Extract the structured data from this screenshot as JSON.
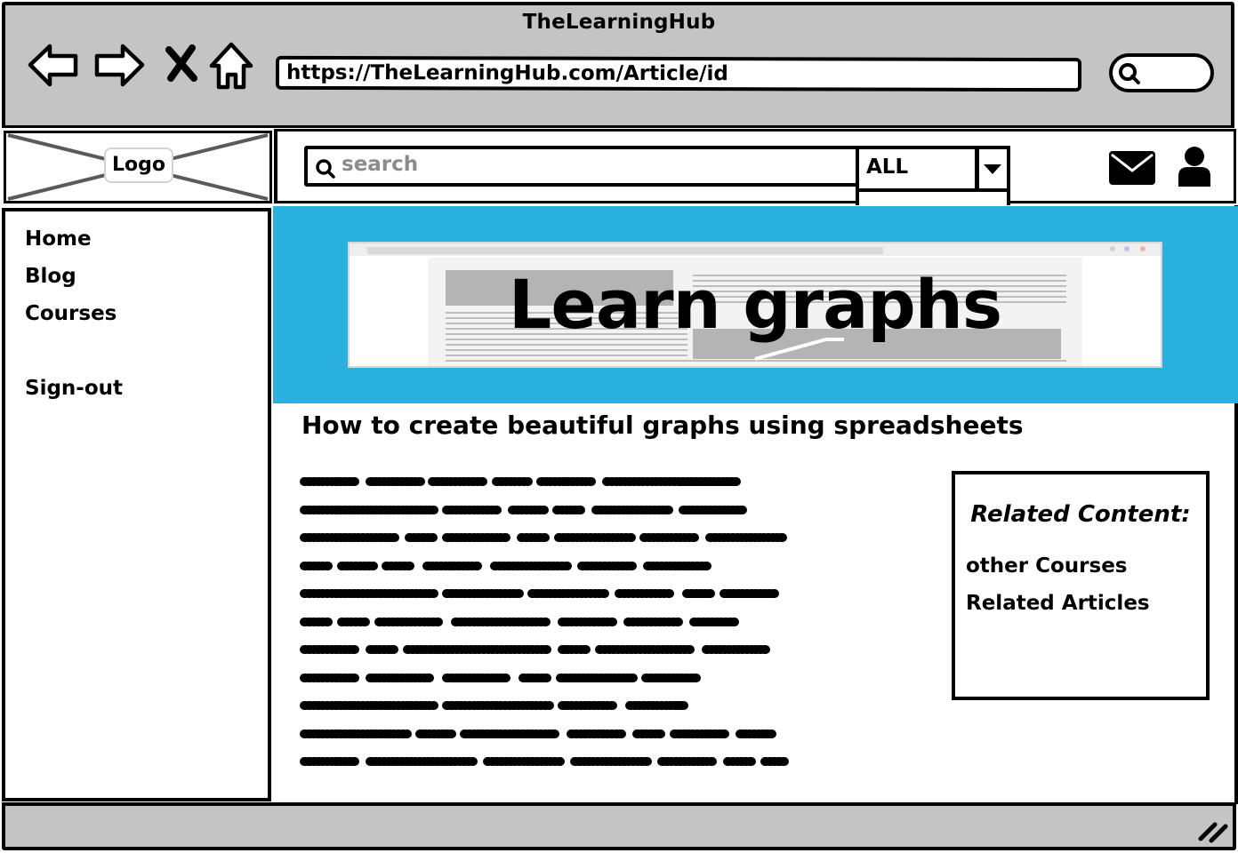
{
  "window": {
    "title": "TheLearningHub",
    "url": "https://TheLearningHub.com/Article/id"
  },
  "header": {
    "logo_label": "Logo",
    "search_placeholder": "search",
    "filter_value": "ALL"
  },
  "sidebar": {
    "items": [
      {
        "label": "Home"
      },
      {
        "label": "Blog"
      },
      {
        "label": "Courses"
      },
      {
        "label": "Sign-out"
      }
    ]
  },
  "main": {
    "hero_title": "Learn graphs",
    "article_heading": "How to create beautiful graphs using spreadsheets",
    "related": {
      "title": "Related Content:",
      "links": [
        {
          "label": "other Courses"
        },
        {
          "label": "Related Articles"
        }
      ]
    }
  },
  "colors": {
    "hero_background": "#29b0dc",
    "chrome_gray": "#c4c4c4"
  }
}
